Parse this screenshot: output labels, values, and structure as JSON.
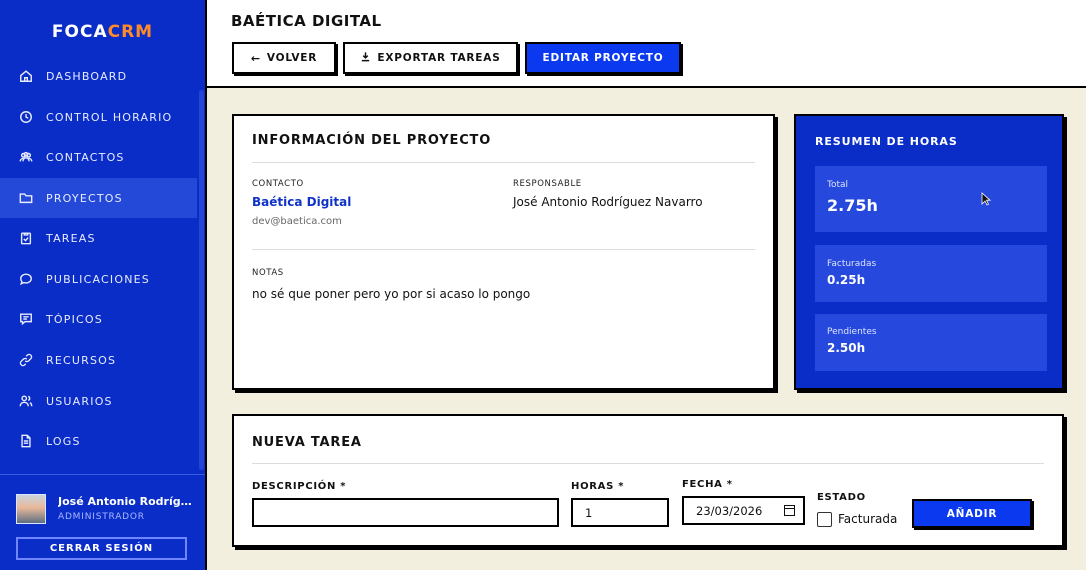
{
  "app": {
    "logo_main": "FOCA",
    "logo_accent": "CRM",
    "accent_color": "#ff8a2a",
    "brand_color": "#0a2dc8"
  },
  "sidebar": {
    "items": [
      {
        "label": "DASHBOARD",
        "icon": "home-icon"
      },
      {
        "label": "CONTROL HORARIO",
        "icon": "clock-icon"
      },
      {
        "label": "CONTACTOS",
        "icon": "users-icon"
      },
      {
        "label": "PROYECTOS",
        "icon": "folder-icon",
        "active": true
      },
      {
        "label": "TAREAS",
        "icon": "clipboard-check-icon"
      },
      {
        "label": "PUBLICACIONES",
        "icon": "chat-bubble-icon"
      },
      {
        "label": "TÓPICOS",
        "icon": "message-square-icon"
      },
      {
        "label": "RECURSOS",
        "icon": "link-icon"
      },
      {
        "label": "USUARIOS",
        "icon": "user-group-icon"
      },
      {
        "label": "LOGS",
        "icon": "document-icon"
      }
    ],
    "user": {
      "name": "José Antonio Rodríguez Navarro",
      "role": "ADMINISTRADOR"
    },
    "logout_label": "CERRAR SESIÓN"
  },
  "header": {
    "title": "BAÉTICA DIGITAL",
    "back_label": "VOLVER",
    "export_label": "EXPORTAR TAREAS",
    "edit_label": "EDITAR PROYECTO"
  },
  "project_info": {
    "title": "INFORMACIÓN DEL PROYECTO",
    "contact_label": "CONTACTO",
    "contact_name": "Baética Digital",
    "contact_email": "dev@baetica.com",
    "responsible_label": "RESPONSABLE",
    "responsible_name": "José Antonio Rodríguez Navarro",
    "notes_label": "NOTAS",
    "notes": "no sé que poner pero yo por si acaso lo pongo"
  },
  "hours_summary": {
    "title": "RESUMEN DE HORAS",
    "total_label": "Total",
    "total_value": "2.75h",
    "billed_label": "Facturadas",
    "billed_value": "0.25h",
    "pending_label": "Pendientes",
    "pending_value": "2.50h"
  },
  "new_task": {
    "title": "NUEVA TAREA",
    "description_label": "DESCRIPCIÓN *",
    "description_value": "",
    "hours_label": "HORAS *",
    "hours_value": "1",
    "date_label": "FECHA *",
    "date_value": "23/03/2026",
    "status_label": "ESTADO",
    "billed_checkbox_label": "Facturada",
    "billed_checked": false,
    "add_label": "AÑADIR"
  }
}
